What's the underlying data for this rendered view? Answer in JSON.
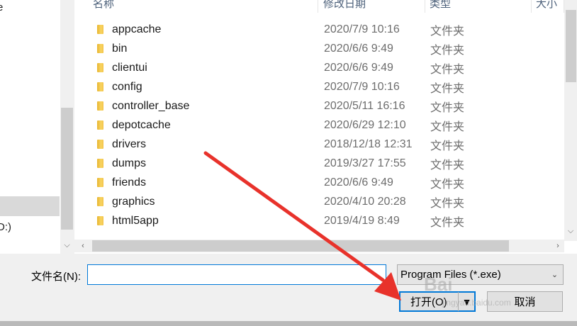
{
  "nav": {
    "partial_label_top": "e",
    "partial_label_drive": "D:)"
  },
  "columns": {
    "name": "名称",
    "modified": "修改日期",
    "type": "类型",
    "size": "大小"
  },
  "files": [
    {
      "name": "appcache",
      "date": "2020/7/9 10:16",
      "type": "文件夹"
    },
    {
      "name": "bin",
      "date": "2020/6/6 9:49",
      "type": "文件夹"
    },
    {
      "name": "clientui",
      "date": "2020/6/6 9:49",
      "type": "文件夹"
    },
    {
      "name": "config",
      "date": "2020/7/9 10:16",
      "type": "文件夹"
    },
    {
      "name": "controller_base",
      "date": "2020/5/11 16:16",
      "type": "文件夹"
    },
    {
      "name": "depotcache",
      "date": "2020/6/29 12:10",
      "type": "文件夹"
    },
    {
      "name": "drivers",
      "date": "2018/12/18 12:31",
      "type": "文件夹"
    },
    {
      "name": "dumps",
      "date": "2019/3/27 17:55",
      "type": "文件夹"
    },
    {
      "name": "friends",
      "date": "2020/6/6 9:49",
      "type": "文件夹"
    },
    {
      "name": "graphics",
      "date": "2020/4/10 20:28",
      "type": "文件夹"
    },
    {
      "name": "html5app",
      "date": "2019/4/19 8:49",
      "type": "文件夹"
    }
  ],
  "footer": {
    "filename_label": "文件名(N):",
    "filename_value": "",
    "filter_value": "Program Files (*.exe)",
    "open_label": "打开(O)",
    "cancel_label": "取消"
  },
  "watermark": {
    "main": "Bai",
    "sub": "jingyan.baidu.com"
  },
  "colors": {
    "accent": "#0078d7",
    "annotation_arrow": "#e8322b",
    "folder": "#f3c44a"
  },
  "icons": {
    "folder": "folder-icon",
    "scroll_up": "chevron-up-icon",
    "scroll_down": "chevron-down-icon",
    "scroll_left": "chevron-left-icon",
    "scroll_right": "chevron-right-icon",
    "dropdown": "chevron-down-icon"
  }
}
